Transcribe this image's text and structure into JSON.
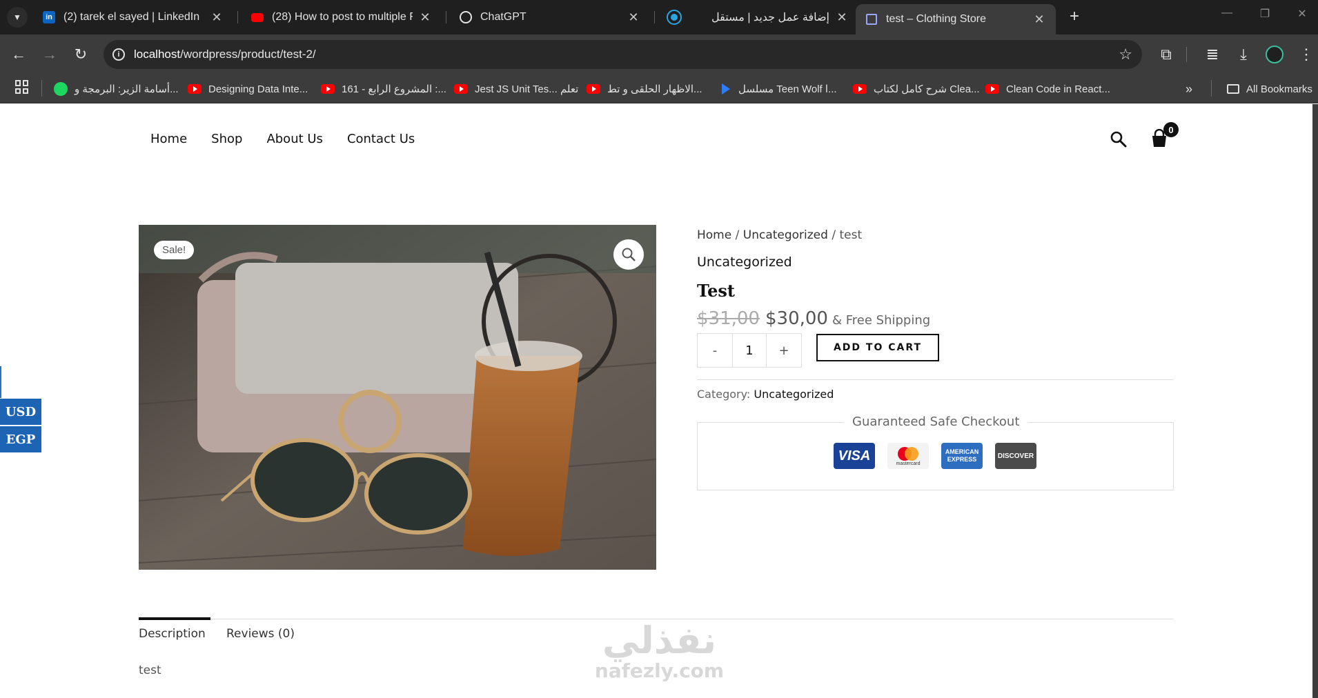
{
  "browser": {
    "tabs": [
      {
        "title": "(2) tarek el sayed | LinkedIn",
        "icon": "linkedin-icon",
        "favicon_text": "in"
      },
      {
        "title": "(28) How to post to multiple Fa",
        "icon": "youtube-icon",
        "favicon_text": ""
      },
      {
        "title": "ChatGPT",
        "icon": "chatgpt-icon",
        "favicon_text": ""
      },
      {
        "title": "إضافة عمل جديد | مستقل",
        "icon": "mostaql-icon",
        "favicon_text": ""
      },
      {
        "title": "test – Clothing Store",
        "icon": "wordpress-icon",
        "favicon_text": ""
      }
    ],
    "url_host": "localhost",
    "url_path": "/wordpress/product/test-2/",
    "bookmarks": [
      {
        "label": "أسامة الزير: البرمجة و...",
        "icon": "spotify-icon"
      },
      {
        "label": "Designing Data Inte...",
        "icon": "youtube-icon"
      },
      {
        "label": "161 - المشروع الرابع :...",
        "icon": "youtube-icon"
      },
      {
        "label": "Jest JS Unit Tes... تعلم",
        "icon": "youtube-icon"
      },
      {
        "label": "الاظهار الحلقى و تط...",
        "icon": "youtube-icon"
      },
      {
        "label": "مسلسل Teen Wolf ا...",
        "icon": "play-icon"
      },
      {
        "label": "شرح كامل لكتاب Clea...",
        "icon": "youtube-icon"
      },
      {
        "label": "Clean Code in React...",
        "icon": "youtube-icon"
      }
    ],
    "all_bookmarks": "All Bookmarks",
    "overflow_glyph": "»"
  },
  "site": {
    "nav": [
      "Home",
      "Shop",
      "About Us",
      "Contact Us"
    ],
    "cart_count": "0"
  },
  "currency": [
    "USD",
    "EGP"
  ],
  "product": {
    "sale_badge": "Sale!",
    "breadcrumb": {
      "home": "Home",
      "sep": " / ",
      "category": "Uncategorized",
      "current": "test"
    },
    "category_title": "Uncategorized",
    "title": "Test",
    "price_old": "$31,00",
    "price_new": "$30,00",
    "shipping": "& Free Shipping",
    "qty_minus": "-",
    "qty_value": "1",
    "qty_plus": "+",
    "add_to_cart": "ADD TO CART",
    "category_label": "Category:",
    "category_value": "Uncategorized",
    "checkout_title": "Guaranteed Safe Checkout",
    "payments": {
      "visa": "VISA",
      "mastercard": "mastercard",
      "amex": "AMERICAN EXPRESS",
      "discover": "DISCOVER"
    }
  },
  "tabs": {
    "description": "Description",
    "reviews": "Reviews (0)",
    "description_text": "test"
  },
  "watermark": {
    "arabic": "نفذلي",
    "latin": "nafezly.com"
  }
}
